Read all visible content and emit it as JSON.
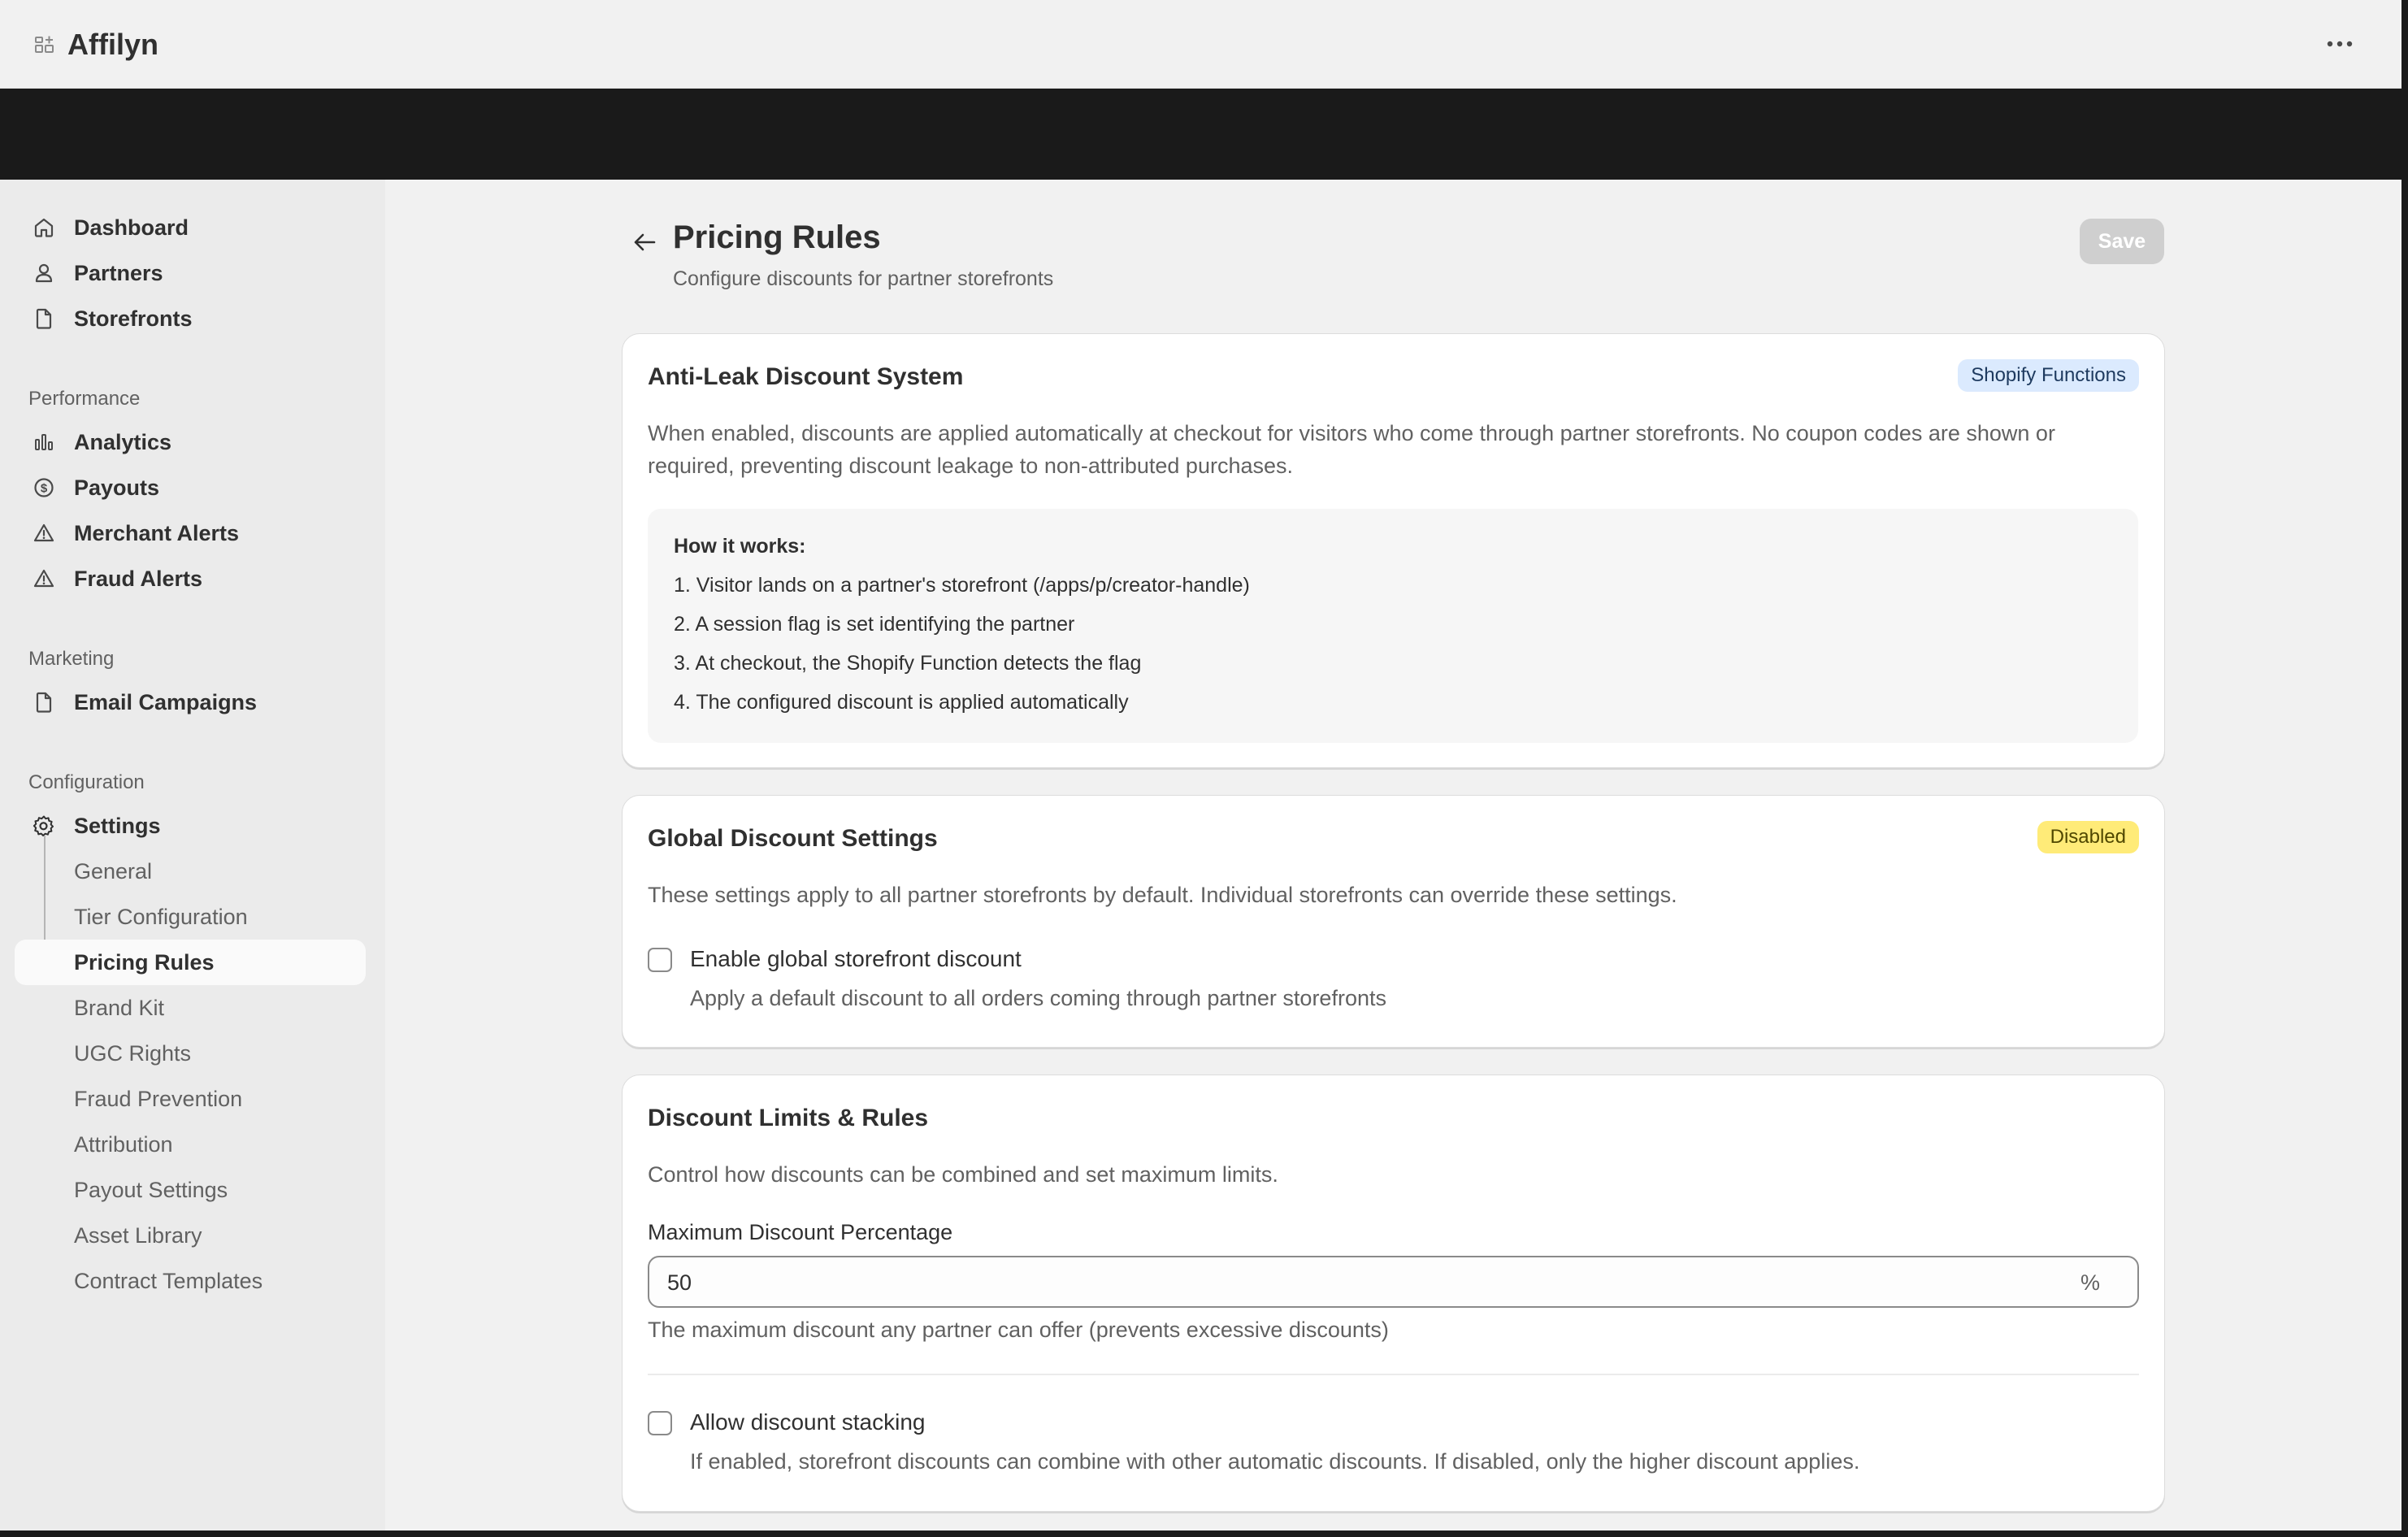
{
  "app": {
    "title": "Affilyn",
    "more_icon": "more-horizontal-icon"
  },
  "sidebar": {
    "primary": [
      {
        "label": "Dashboard",
        "icon": "home-icon"
      },
      {
        "label": "Partners",
        "icon": "person-icon"
      },
      {
        "label": "Storefronts",
        "icon": "file-icon"
      }
    ],
    "performance": {
      "heading": "Performance",
      "items": [
        {
          "label": "Analytics",
          "icon": "bar-chart-icon"
        },
        {
          "label": "Payouts",
          "icon": "dollar-circle-icon"
        },
        {
          "label": "Merchant Alerts",
          "icon": "alert-triangle-icon"
        },
        {
          "label": "Fraud Alerts",
          "icon": "alert-triangle-icon"
        }
      ]
    },
    "marketing": {
      "heading": "Marketing",
      "items": [
        {
          "label": "Email Campaigns",
          "icon": "file-icon"
        }
      ]
    },
    "configuration": {
      "heading": "Configuration",
      "settings": {
        "label": "Settings",
        "icon": "gear-icon"
      },
      "sub_items": [
        {
          "label": "General",
          "active": false
        },
        {
          "label": "Tier Configuration",
          "active": false
        },
        {
          "label": "Pricing Rules",
          "active": true
        },
        {
          "label": "Brand Kit",
          "active": false
        },
        {
          "label": "UGC Rights",
          "active": false
        },
        {
          "label": "Fraud Prevention",
          "active": false
        },
        {
          "label": "Attribution",
          "active": false
        },
        {
          "label": "Payout Settings",
          "active": false
        },
        {
          "label": "Asset Library",
          "active": false
        },
        {
          "label": "Contract Templates",
          "active": false
        }
      ]
    }
  },
  "header": {
    "title": "Pricing Rules",
    "subtitle": "Configure discounts for partner storefronts",
    "save_label": "Save",
    "back_icon": "arrow-left-icon"
  },
  "anti_leak": {
    "title": "Anti-Leak Discount System",
    "badge": "Shopify Functions",
    "description": "When enabled, discounts are applied automatically at checkout for visitors who come through partner storefronts. No coupon codes are shown or required, preventing discount leakage to non-attributed purchases.",
    "how_title": "How it works:",
    "steps": [
      "1. Visitor lands on a partner's storefront (/apps/p/creator-handle)",
      "2. A session flag is set identifying the partner",
      "3. At checkout, the Shopify Function detects the flag",
      "4. The configured discount is applied automatically"
    ]
  },
  "global_discount": {
    "title": "Global Discount Settings",
    "badge": "Disabled",
    "description": "These settings apply to all partner storefronts by default. Individual storefronts can override these settings.",
    "checkbox_label": "Enable global storefront discount",
    "checkbox_checked": false,
    "checkbox_help": "Apply a default discount to all orders coming through partner storefronts"
  },
  "limits": {
    "title": "Discount Limits & Rules",
    "description": "Control how discounts can be combined and set maximum limits.",
    "max_label": "Maximum Discount Percentage",
    "max_value": "50",
    "max_suffix": "%",
    "max_help": "The maximum discount any partner can offer (prevents excessive discounts)",
    "stacking_label": "Allow discount stacking",
    "stacking_checked": false,
    "stacking_help": "If enabled, storefront discounts can combine with other automatic discounts. If disabled, only the higher discount applies."
  },
  "colors": {
    "info_badge_bg": "#dbeafe",
    "warning_badge_bg": "#ffeb78",
    "save_disabled_bg": "#cfcfcf"
  }
}
